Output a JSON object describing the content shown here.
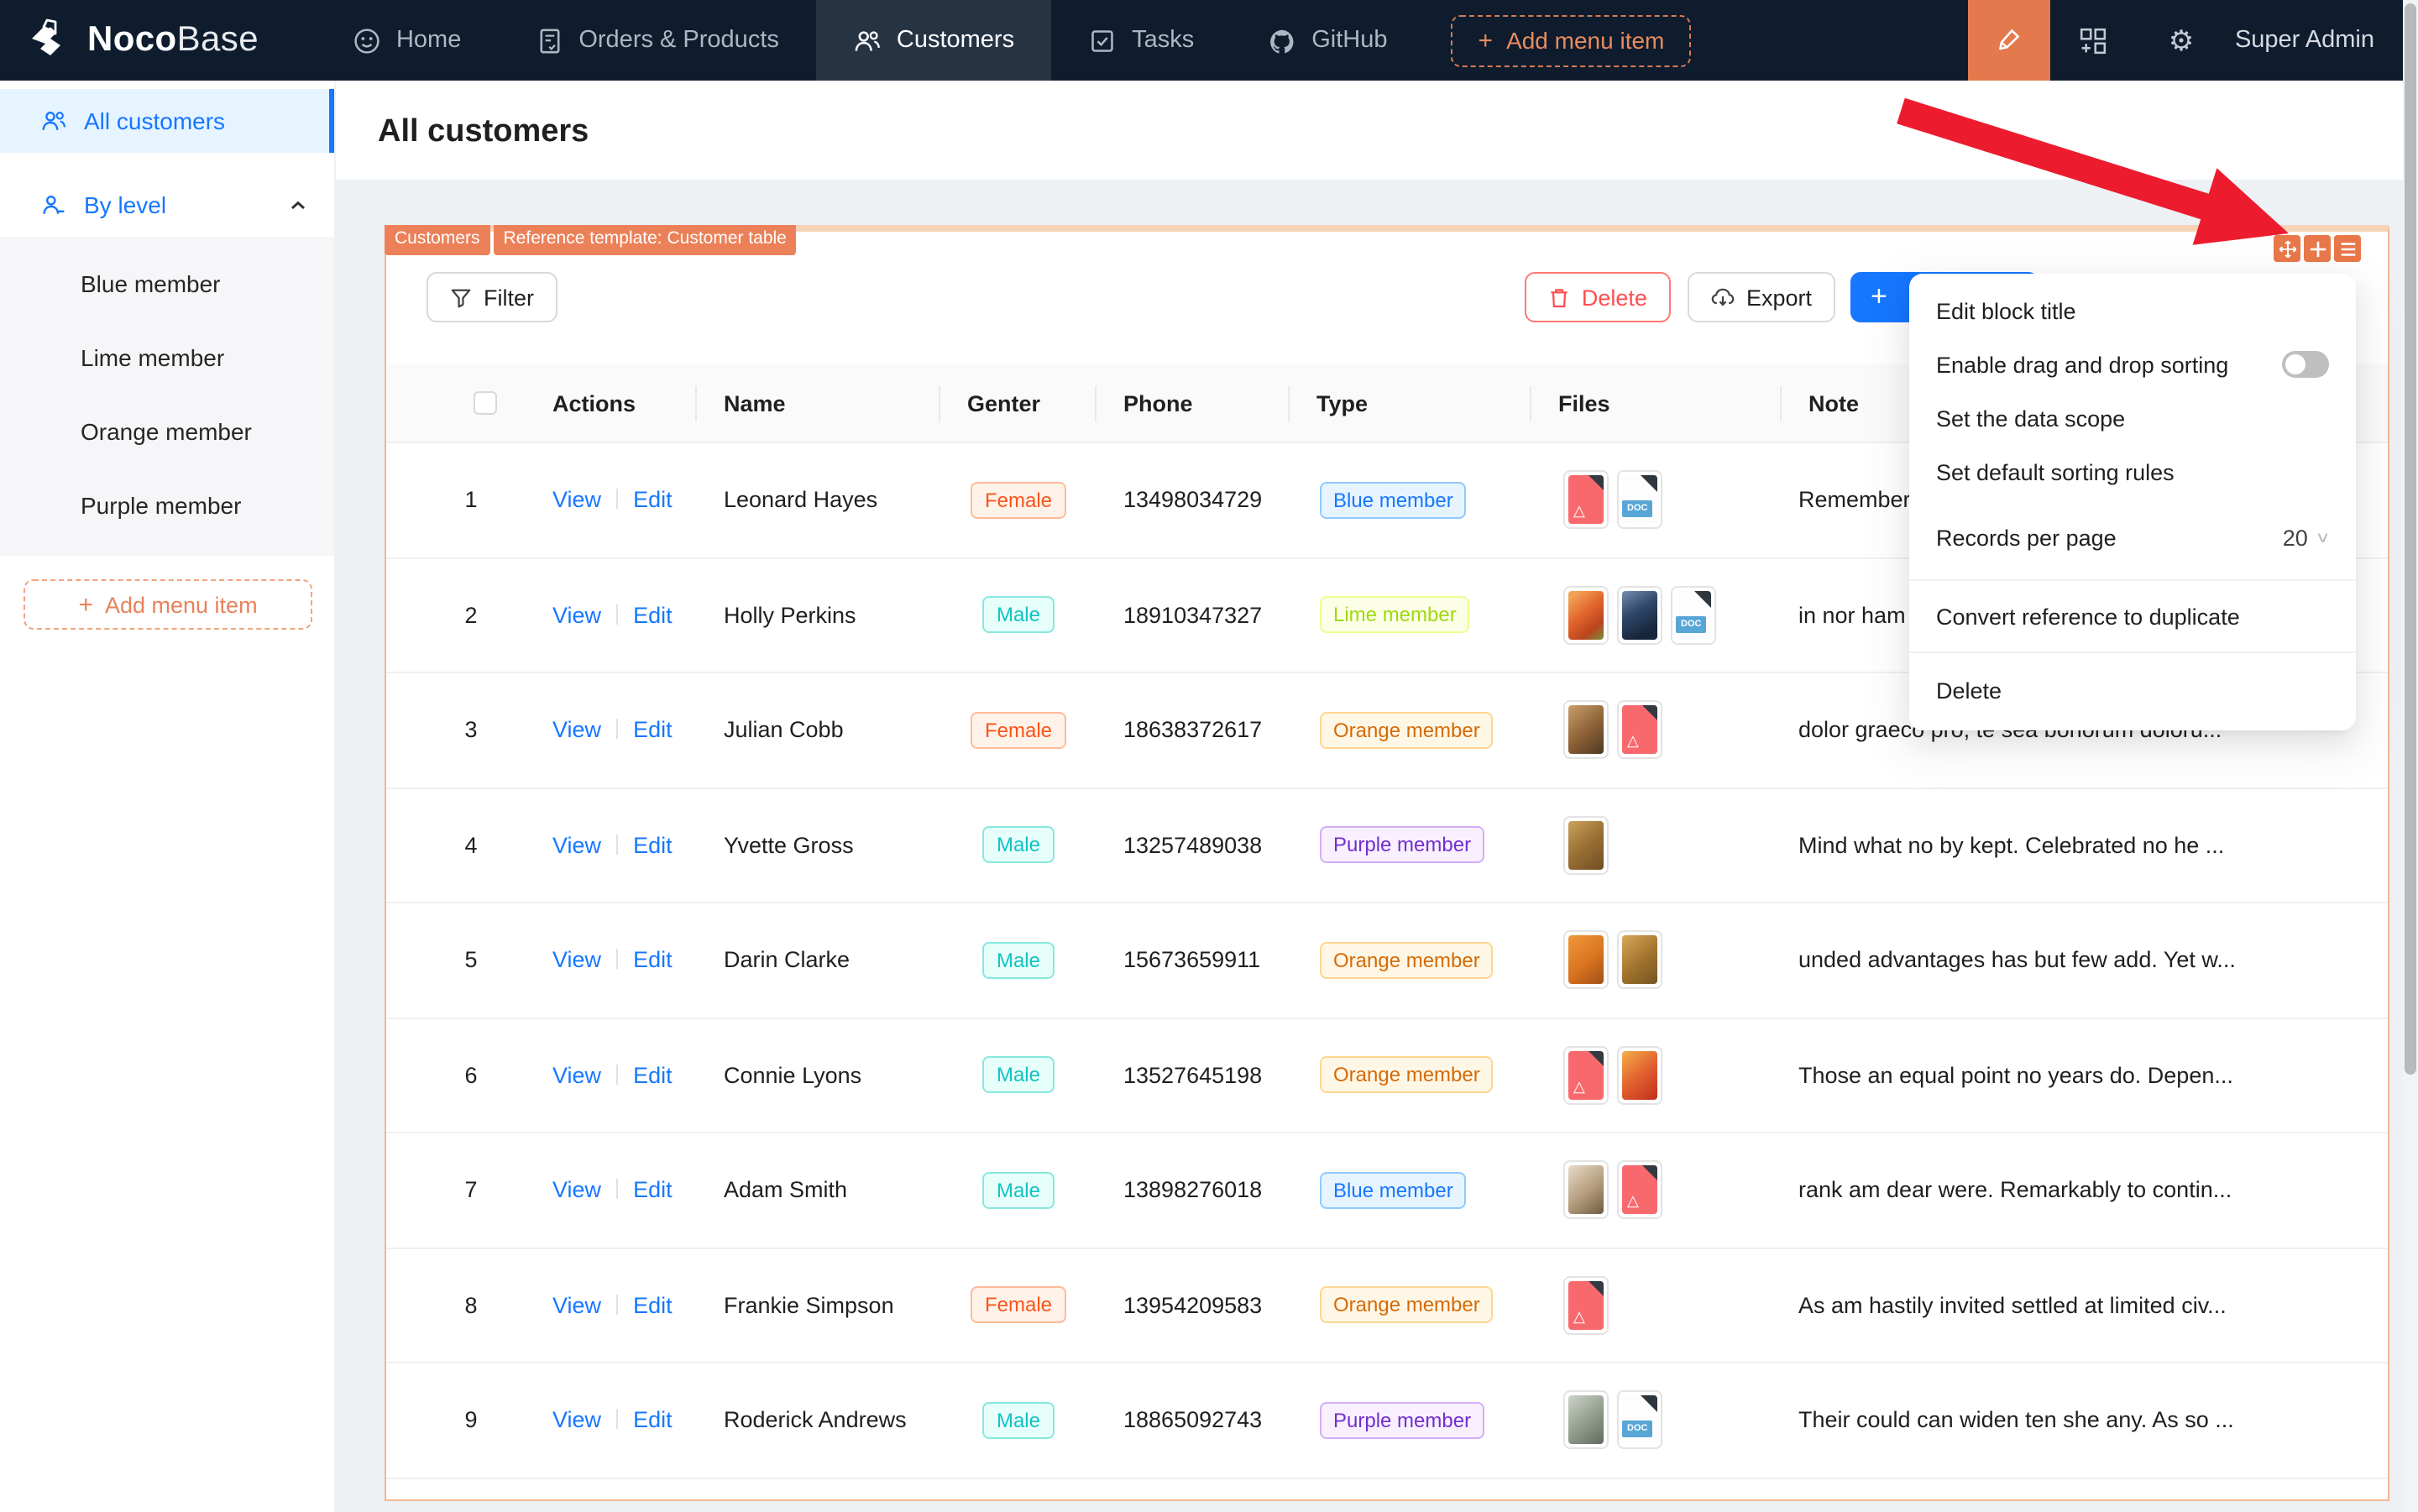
{
  "navbar": {
    "brand": {
      "bold": "Noco",
      "light": "Base"
    },
    "items": [
      {
        "label": "Home",
        "icon": "smiley-icon",
        "active": false
      },
      {
        "label": "Orders & Products",
        "icon": "orders-icon",
        "active": false
      },
      {
        "label": "Customers",
        "icon": "team-icon",
        "active": true
      },
      {
        "label": "Tasks",
        "icon": "task-check-icon",
        "active": false
      },
      {
        "label": "GitHub",
        "icon": "github-icon",
        "active": false
      }
    ],
    "add_menu_item_label": "Add menu item",
    "user": "Super Admin"
  },
  "sidebar": {
    "all_customers_label": "All customers",
    "by_level_label": "By level",
    "sub_items": [
      "Blue member",
      "Lime member",
      "Orange member",
      "Purple member"
    ],
    "add_menu_item_label": "Add menu item"
  },
  "page": {
    "title": "All customers"
  },
  "block": {
    "tags": [
      "Customers",
      "Reference template: Customer table"
    ],
    "corner_icons": [
      "drag-handle-icon",
      "add-block-icon",
      "block-settings-icon"
    ],
    "toolbar": {
      "filter": "Filter",
      "delete": "Delete",
      "export": "Export",
      "add_new": "+"
    },
    "settings_menu": {
      "items": [
        {
          "label": "Edit block title"
        },
        {
          "label": "Enable drag and drop sorting",
          "control": "switch",
          "state": "off"
        },
        {
          "label": "Set the data scope"
        },
        {
          "label": "Set default sorting rules"
        },
        {
          "label": "Records per page",
          "value": "20"
        },
        {
          "divider": true
        },
        {
          "label": "Convert reference to duplicate"
        },
        {
          "divider": true
        },
        {
          "label": "Delete"
        }
      ]
    },
    "table": {
      "columns": [
        "",
        "Actions",
        "Name",
        "Genter",
        "Phone",
        "Type",
        "Files",
        "Note"
      ],
      "action_labels": [
        "View",
        "Edit"
      ],
      "rows": [
        {
          "num": "1",
          "name": "Leonard Hayes",
          "gender": "Female",
          "phone": "13498034729",
          "type": "Blue member",
          "files": [
            "pdf",
            "doc"
          ],
          "note": "Remember"
        },
        {
          "num": "2",
          "name": "Holly Perkins",
          "gender": "Male",
          "phone": "18910347327",
          "type": "Lime member",
          "files": [
            "photo:orange",
            "photo:dark",
            "doc"
          ],
          "note": "in nor ham"
        },
        {
          "num": "3",
          "name": "Julian Cobb",
          "gender": "Female",
          "phone": "18638372617",
          "type": "Orange member",
          "files": [
            "photo:food",
            "pdf"
          ],
          "note": "dolor graeco pro, te sea bonorum doloru..."
        },
        {
          "num": "4",
          "name": "Yvette Gross",
          "gender": "Male",
          "phone": "13257489038",
          "type": "Purple member",
          "files": [
            "photo:basket"
          ],
          "note": "Mind what no by kept. Celebrated no he ..."
        },
        {
          "num": "5",
          "name": "Darin Clarke",
          "gender": "Male",
          "phone": "15673659911",
          "type": "Orange member",
          "files": [
            "photo:oranges",
            "photo:basket2"
          ],
          "note": "unded advantages has but few add. Yet w..."
        },
        {
          "num": "6",
          "name": "Connie Lyons",
          "gender": "Male",
          "phone": "13527645198",
          "type": "Orange member",
          "files": [
            "pdf",
            "photo:peppers"
          ],
          "note": "Those an equal point no years do. Depen..."
        },
        {
          "num": "7",
          "name": "Adam Smith",
          "gender": "Male",
          "phone": "13898276018",
          "type": "Blue member",
          "files": [
            "photo:plate",
            "pdf"
          ],
          "note": "rank am dear were. Remarkably to contin..."
        },
        {
          "num": "8",
          "name": "Frankie Simpson",
          "gender": "Female",
          "phone": "13954209583",
          "type": "Orange member",
          "files": [
            "pdf"
          ],
          "note": "As am hastily invited settled at limited civ..."
        },
        {
          "num": "9",
          "name": "Roderick Andrews",
          "gender": "Male",
          "phone": "18865092743",
          "type": "Purple member",
          "files": [
            "photo:shelf",
            "doc"
          ],
          "note": "Their could can widen ten she any. As so ..."
        }
      ]
    }
  },
  "tag_styles": {
    "Female": {
      "bg": "#fff2e8",
      "border": "#ffbb96",
      "text": "#fa541c"
    },
    "Male": {
      "bg": "#e6fffb",
      "border": "#87e8de",
      "text": "#13c2c2"
    },
    "Blue member": {
      "bg": "#e6f4ff",
      "border": "#91caff",
      "text": "#1677ff"
    },
    "Lime member": {
      "bg": "#fcffe6",
      "border": "#eaff8f",
      "text": "#a0d911"
    },
    "Orange member": {
      "bg": "#fff7e6",
      "border": "#ffd591",
      "text": "#d46b08"
    },
    "Purple member": {
      "bg": "#f9f0ff",
      "border": "#d3adf7",
      "text": "#722ed1"
    }
  },
  "colors": {
    "accent_orange": "#ec8159",
    "primary_blue": "#1677ff",
    "arrow_red": "#ec1c2e",
    "navbar_bg": "#0e1c2e"
  }
}
